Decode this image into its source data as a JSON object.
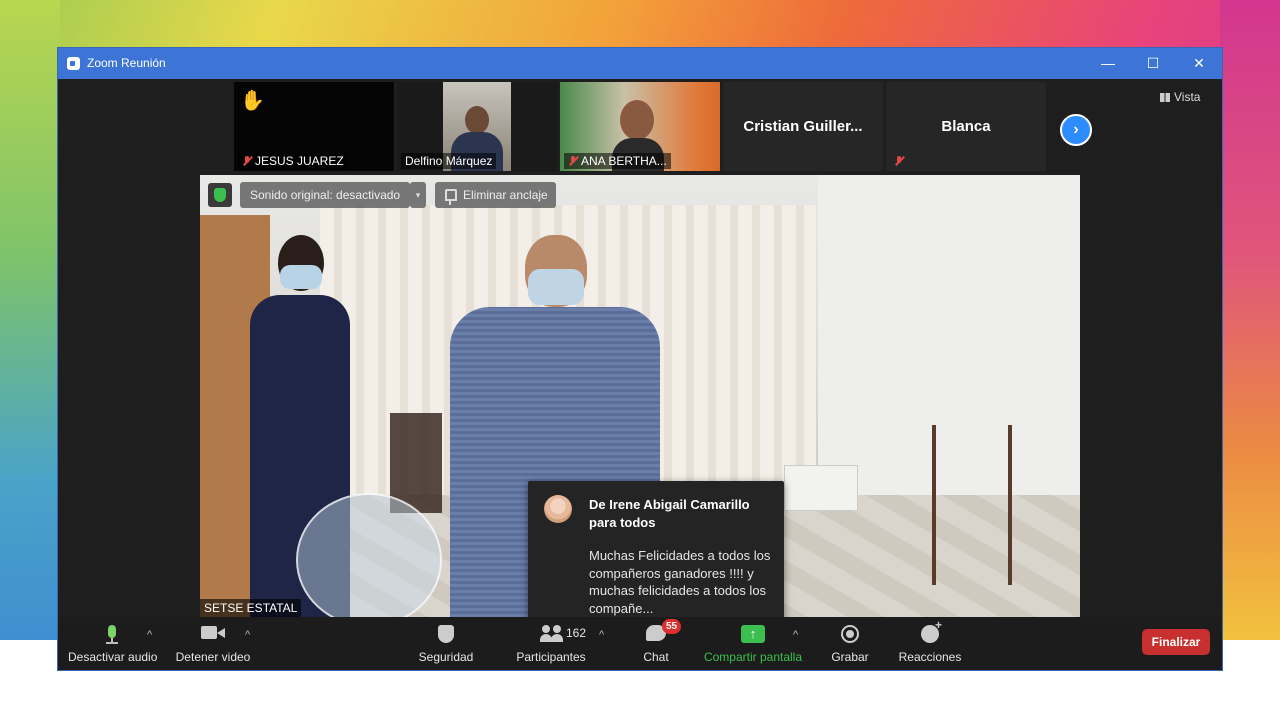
{
  "window": {
    "title": "Zoom Reunión",
    "minimize_glyph": "—",
    "maximize_glyph": "☐",
    "close_glyph": "✕"
  },
  "gallery": {
    "participants": [
      {
        "name": "JESUS JUAREZ",
        "muted": true,
        "hand_raised": true,
        "hand_glyph": "✋"
      },
      {
        "name": "Delfino Márquez",
        "muted": false
      },
      {
        "name": "ANA BERTHA...",
        "muted": true
      },
      {
        "display_name": "Cristian  Guiller..."
      },
      {
        "display_name": "Blanca",
        "muted": true
      }
    ],
    "next_glyph": "›"
  },
  "view_button": {
    "label": "Vista"
  },
  "main_video": {
    "original_sound": "Sonido original: desactivado",
    "dropdown_glyph": "▾",
    "unpin_label": "Eliminar anclaje",
    "speaker_name": "SETSE ESTATAL"
  },
  "chat_toast": {
    "from": "De Irene Abigail Camarillo para todos",
    "message": "Muchas Felicidades a todos los compañeros ganadores !!!! y muchas felicidades a todos los compañe..."
  },
  "toolbar": {
    "mute_label": "Desactivar audio",
    "video_label": "Detener video",
    "security_label": "Seguridad",
    "participants_label": "Participantes",
    "participants_count": "162",
    "chat_label": "Chat",
    "chat_badge": "55",
    "share_label": "Compartir pantalla",
    "share_glyph": "↑",
    "record_label": "Grabar",
    "reactions_label": "Reacciones",
    "caret_glyph": "^",
    "end_label": "Finalizar"
  },
  "colors": {
    "title_bar": "#3c75d6",
    "share_green": "#3cbf4e",
    "end_red": "#c7302e",
    "badge_red": "#e02d2d",
    "accent_blue": "#2d8cff"
  }
}
